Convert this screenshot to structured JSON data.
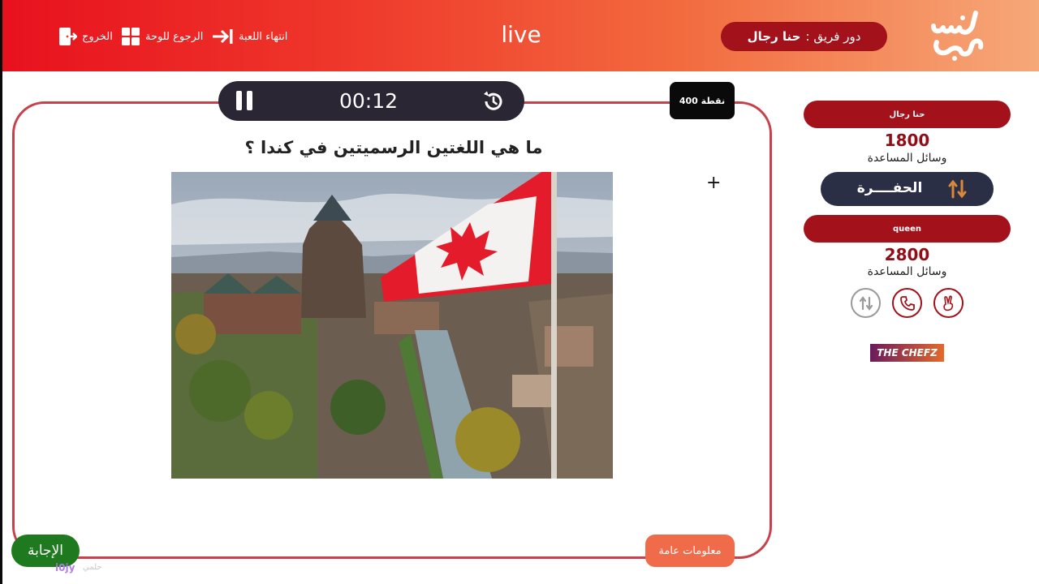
{
  "header": {
    "exit_label": "الخروج",
    "board_label": "الرجوع للوحة",
    "end_game_label": "انتهاء اللعبة",
    "live_label": "live",
    "turn_prefix": "دور فريق :",
    "turn_team": "حنا رجال",
    "logo_text": "سين جيم"
  },
  "question_panel": {
    "timer": "00:12",
    "points_badge": "400 نقطة",
    "question": "ما هي اللغتين الرسميتين في كندا ؟",
    "category": "معلومات عامة",
    "answer_button": "الإجابة"
  },
  "teams": [
    {
      "name": "حنا رجال",
      "score": "1800",
      "aids_label": "وسائل المساعدة",
      "aid_items": [
        "الحفــــرة"
      ]
    },
    {
      "name": "queen",
      "score": "2800",
      "aids_label": "وسائل المساعدة",
      "aid_items": [
        "swap-arrows-icon",
        "phone-icon",
        "two-fingers-icon"
      ]
    }
  ],
  "sponsor": "THE CHEFZ",
  "watermark": {
    "handle": "i0jy",
    "text": "حلمي"
  },
  "colors": {
    "brand_red": "#e8111e",
    "dark_red": "#a3111a",
    "dark_pill": "#2a2633",
    "answer_green": "#1f7a1f",
    "category_orange": "#f06b4a"
  }
}
